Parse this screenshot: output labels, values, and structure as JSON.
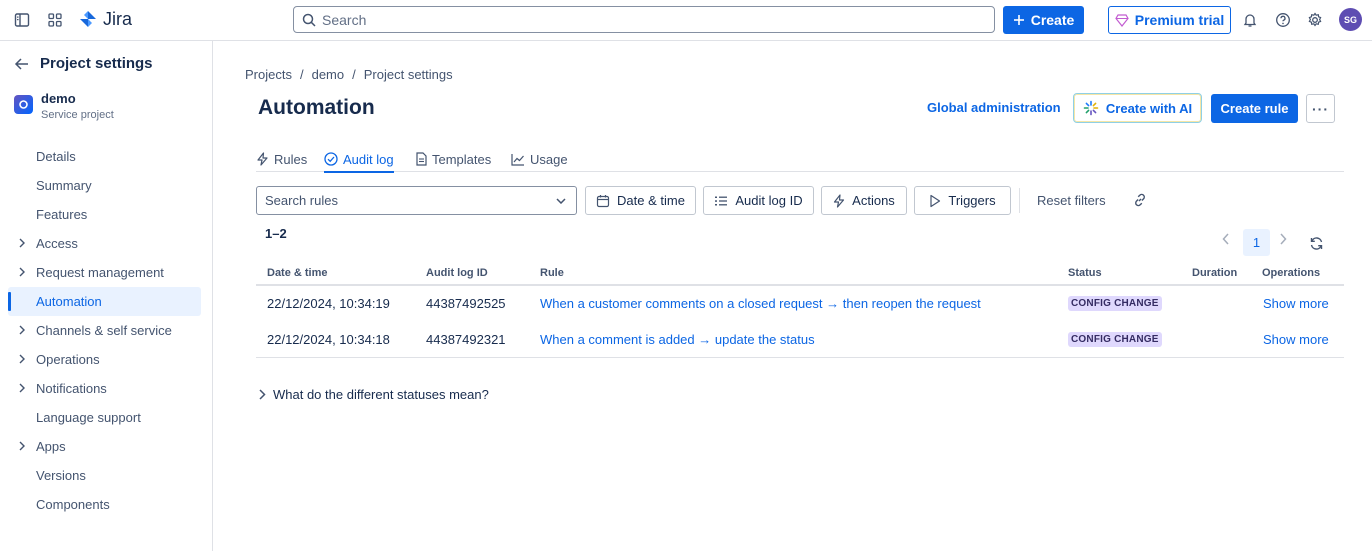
{
  "topbar": {
    "app_name": "Jira",
    "search_placeholder": "Search",
    "create_label": "Create",
    "premium_label": "Premium trial",
    "avatar_initials": "SG"
  },
  "sidebar": {
    "title": "Project settings",
    "project_name": "demo",
    "project_type": "Service project",
    "items": [
      {
        "label": "Details",
        "expandable": false
      },
      {
        "label": "Summary",
        "expandable": false
      },
      {
        "label": "Features",
        "expandable": false
      },
      {
        "label": "Access",
        "expandable": true
      },
      {
        "label": "Request management",
        "expandable": true
      },
      {
        "label": "Automation",
        "expandable": false,
        "active": true
      },
      {
        "label": "Channels & self service",
        "expandable": true
      },
      {
        "label": "Operations",
        "expandable": true
      },
      {
        "label": "Notifications",
        "expandable": true
      },
      {
        "label": "Language support",
        "expandable": false
      },
      {
        "label": "Apps",
        "expandable": true
      },
      {
        "label": "Versions",
        "expandable": false
      },
      {
        "label": "Components",
        "expandable": false
      }
    ]
  },
  "breadcrumbs": [
    "Projects",
    "demo",
    "Project settings"
  ],
  "breadcrumb_sep": "/",
  "header": {
    "title": "Automation",
    "global_admin": "Global administration",
    "create_ai": "Create with AI",
    "create_rule": "Create rule",
    "more": "···"
  },
  "tabs": [
    {
      "label": "Rules",
      "icon": "lightning-icon"
    },
    {
      "label": "Audit log",
      "icon": "check-circle-icon",
      "active": true
    },
    {
      "label": "Templates",
      "icon": "document-icon"
    },
    {
      "label": "Usage",
      "icon": "chart-line-icon"
    }
  ],
  "filters": {
    "search_placeholder": "Search rules",
    "date_time": "Date & time",
    "audit_log_id": "Audit log ID",
    "actions": "Actions",
    "triggers": "Triggers",
    "reset": "Reset filters"
  },
  "results": {
    "count": "1–2",
    "page": "1"
  },
  "table": {
    "columns": [
      "Date & time",
      "Audit log ID",
      "Rule",
      "Status",
      "Duration",
      "Operations"
    ],
    "rows": [
      {
        "date": "22/12/2024, 10:34:19",
        "id": "44387492525",
        "rule": "When a customer comments on a closed request → then reopen the request",
        "status": "CONFIG CHANGE",
        "duration": "",
        "operation": "Show more"
      },
      {
        "date": "22/12/2024, 10:34:18",
        "id": "44387492321",
        "rule": "When a comment is added → update the status",
        "status": "CONFIG CHANGE",
        "duration": "",
        "operation": "Show more"
      }
    ]
  },
  "footer_question": "What do the different statuses mean?",
  "colors": {
    "primary": "#0c66e4",
    "badge_bg": "#dfd8fd",
    "text": "#172b4d",
    "subtle": "#44546f"
  }
}
